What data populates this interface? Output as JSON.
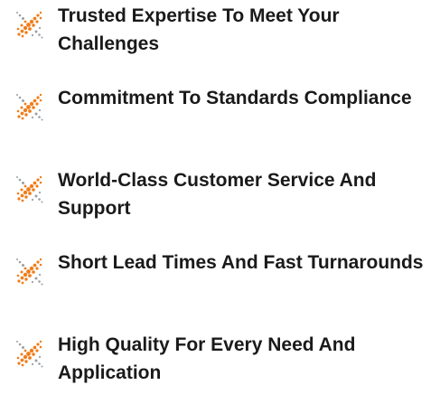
{
  "features": [
    {
      "icon": "dotted-sparkle-icon",
      "text": "Trusted Expertise To Meet Your Challenges"
    },
    {
      "icon": "dotted-sparkle-icon",
      "text": "Commitment To Standards Compliance"
    },
    {
      "icon": "dotted-sparkle-icon",
      "text": "World-Class Customer Service And Support"
    },
    {
      "icon": "dotted-sparkle-icon",
      "text": "Short Lead Times And Fast Turnarounds"
    },
    {
      "icon": "dotted-sparkle-icon",
      "text": "High Quality For Every Need And Application"
    }
  ],
  "colors": {
    "icon_orange": "#f07d1a",
    "icon_gray": "#9aa0a6",
    "text": "#1a1a1a"
  }
}
